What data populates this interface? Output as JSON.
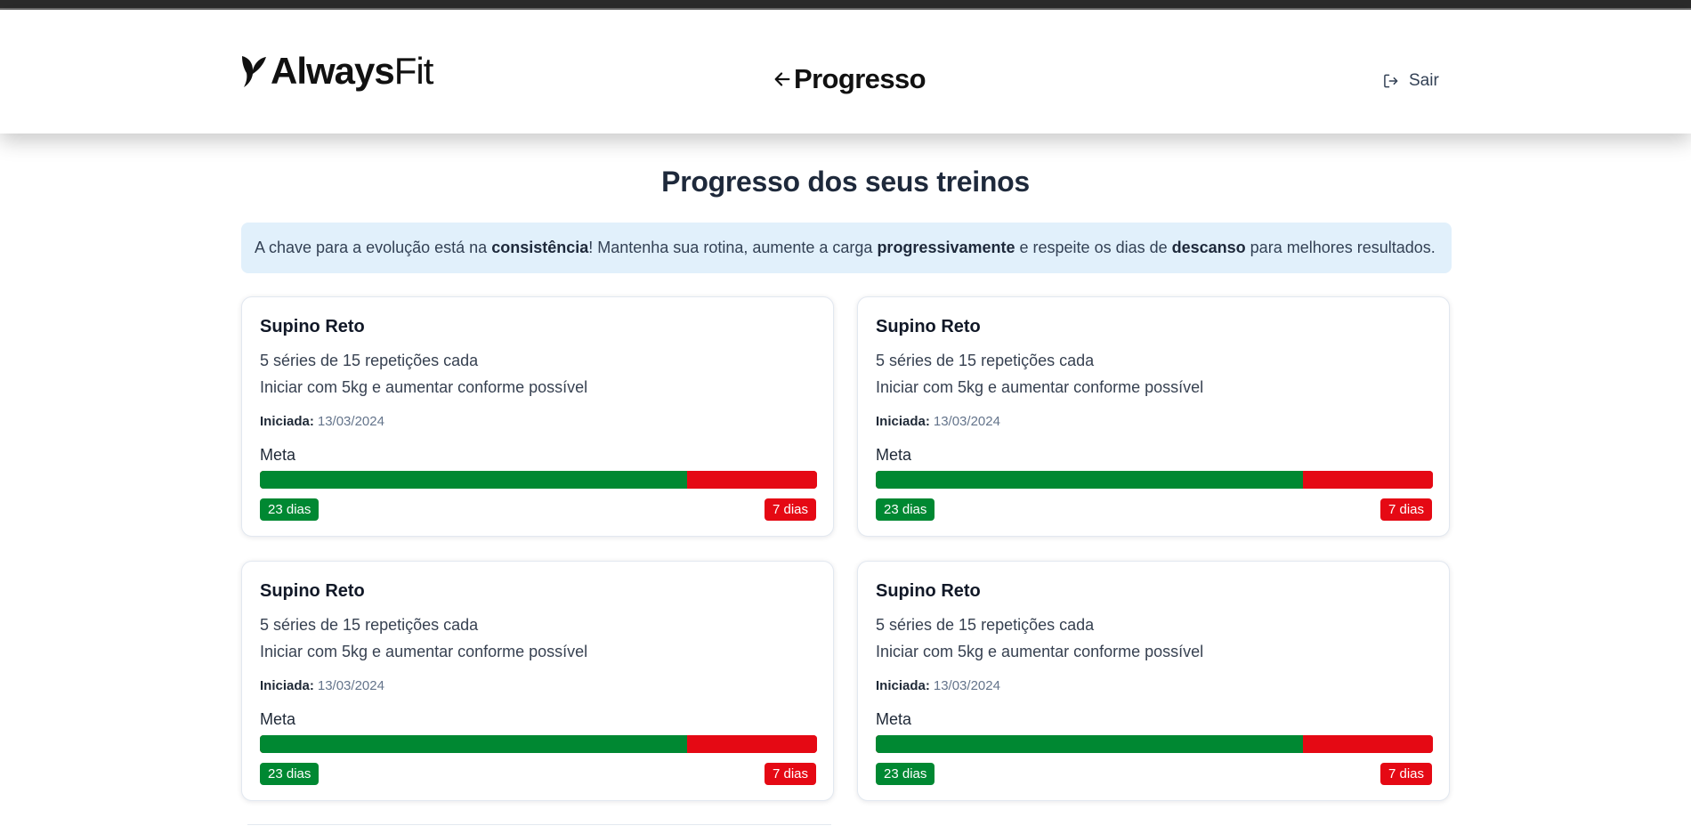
{
  "header": {
    "logo_bold": "Always",
    "logo_light": "Fit",
    "nav_title": "Progresso",
    "logout_label": "Sair"
  },
  "main": {
    "heading": "Progresso dos seus treinos",
    "tip": {
      "t1": "A chave para a evolução está na ",
      "b1": "consistência",
      "t2": "! Mantenha sua rotina, aumente a carga ",
      "b2": "progressivamente",
      "t3": " e respeite os dias de ",
      "b3": "descanso",
      "t4": " para melhores resultados."
    },
    "cards": [
      {
        "name": "Supino Reto",
        "sets": "5 séries de 15 repetições cada",
        "instructions": "Iniciar com 5kg e aumentar conforme possível",
        "started_label": "Iniciada:",
        "started_date": "13/03/2024",
        "goal_label": "Meta",
        "progress_fraction": 0.7667,
        "done_label": "23 dias",
        "remaining_label": "7 dias"
      },
      {
        "name": "Supino Reto",
        "sets": "5 séries de 15 repetições cada",
        "instructions": "Iniciar com 5kg e aumentar conforme possível",
        "started_label": "Iniciada:",
        "started_date": "13/03/2024",
        "goal_label": "Meta",
        "progress_fraction": 0.7667,
        "done_label": "23 dias",
        "remaining_label": "7 dias"
      },
      {
        "name": "Supino Reto",
        "sets": "5 séries de 15 repetições cada",
        "instructions": "Iniciar com 5kg e aumentar conforme possível",
        "started_label": "Iniciada:",
        "started_date": "13/03/2024",
        "goal_label": "Meta",
        "progress_fraction": 0.7667,
        "done_label": "23 dias",
        "remaining_label": "7 dias"
      },
      {
        "name": "Supino Reto",
        "sets": "5 séries de 15 repetições cada",
        "instructions": "Iniciar com 5kg e aumentar conforme possível",
        "started_label": "Iniciada:",
        "started_date": "13/03/2024",
        "goal_label": "Meta",
        "progress_fraction": 0.7667,
        "done_label": "23 dias",
        "remaining_label": "7 dias"
      }
    ]
  },
  "colors": {
    "done": "#008832",
    "remaining": "#e50914",
    "tip_background": "#e1f0fb"
  },
  "icons": {
    "logo": "leaf-logo-icon",
    "back": "arrow-left-icon",
    "logout": "logout-icon"
  }
}
